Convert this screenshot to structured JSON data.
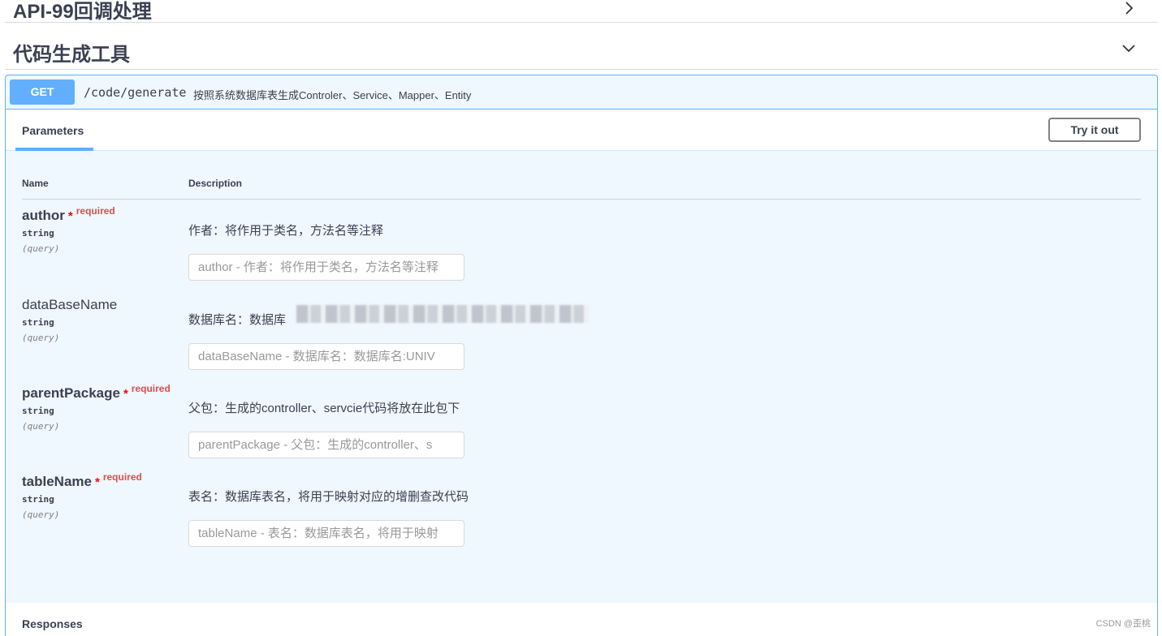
{
  "tags": [
    {
      "title": "API-99回调处理",
      "expanded": false,
      "icon": "chevron-right-icon"
    },
    {
      "title": "代码生成工具",
      "expanded": true,
      "icon": "chevron-down-icon"
    }
  ],
  "operation": {
    "method": "GET",
    "path": "/code/generate",
    "summary": "按照系统数据库表生成Controler、Service、Mapper、Entity",
    "color": "#61affe"
  },
  "parameters_tab": {
    "label": "Parameters",
    "try_it_out": "Try it out",
    "col_name": "Name",
    "col_description": "Description"
  },
  "params": [
    {
      "name": "author",
      "required": true,
      "required_label": "required",
      "type": "string",
      "in": "(query)",
      "description": "作者：将作用于类名，方法名等注释",
      "placeholder": "author - 作者：将作用于类名，方法名等注释"
    },
    {
      "name": "dataBaseName",
      "required": false,
      "type": "string",
      "in": "(query)",
      "description": "数据库名：数据库",
      "placeholder": "dataBaseName - 数据库名：数据库名:UNIV"
    },
    {
      "name": "parentPackage",
      "required": true,
      "required_label": "required",
      "type": "string",
      "in": "(query)",
      "description": "父包：生成的controller、servcie代码将放在此包下",
      "placeholder": "parentPackage - 父包：生成的controller、s"
    },
    {
      "name": "tableName",
      "required": true,
      "required_label": "required",
      "type": "string",
      "in": "(query)",
      "description": "表名：数据库表名，将用于映射对应的增删查改代码",
      "placeholder": "tableName - 表名：数据库表名，将用于映射"
    }
  ],
  "responses": {
    "label": "Responses"
  },
  "watermark": "CSDN @歪桃"
}
